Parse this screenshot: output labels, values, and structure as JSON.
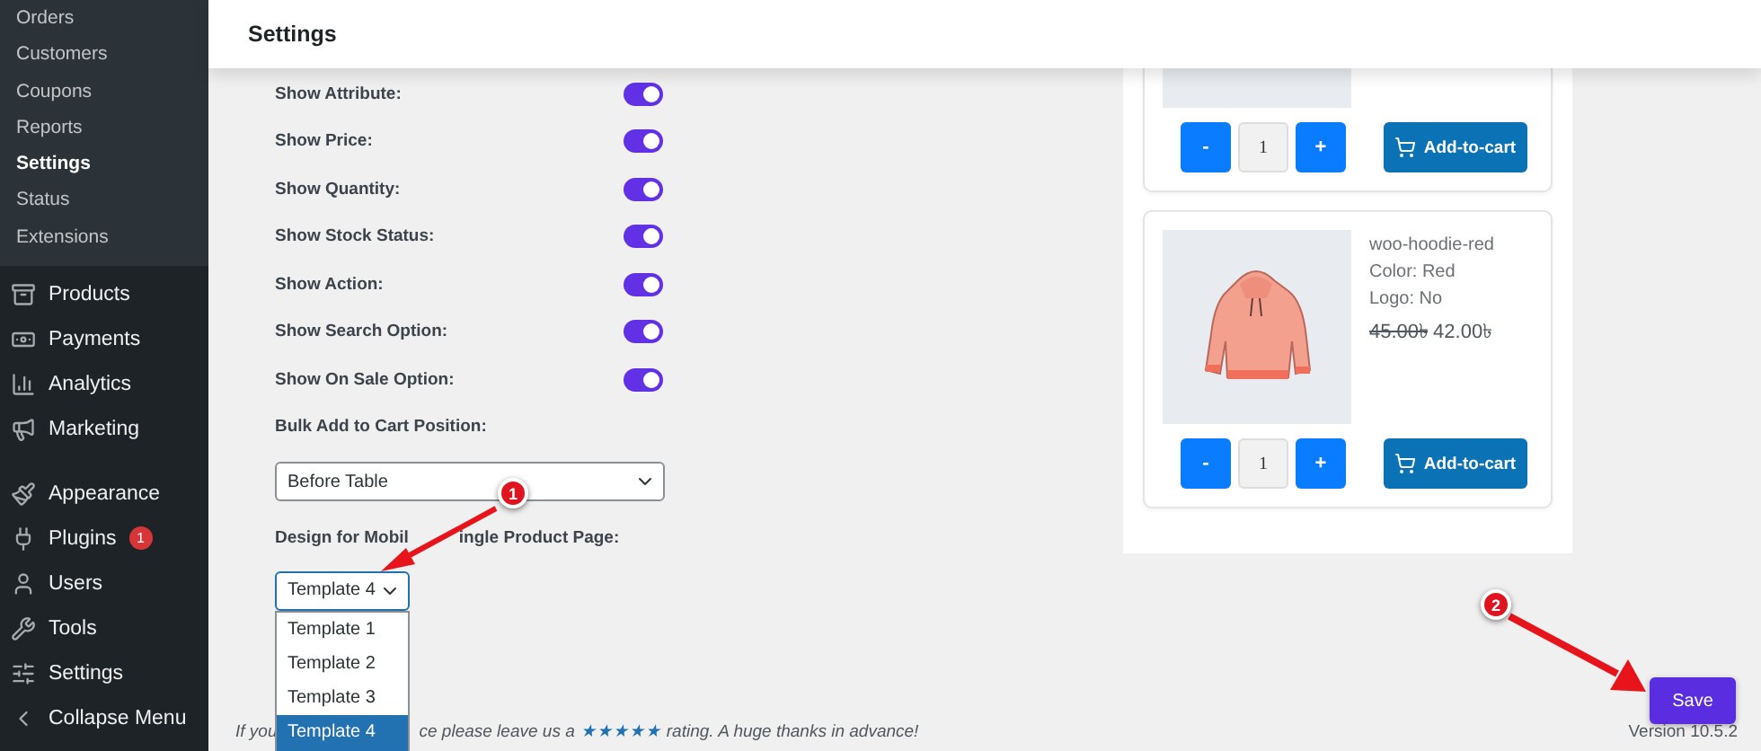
{
  "sidebar": {
    "submenu": [
      {
        "label": "Orders",
        "selected": false
      },
      {
        "label": "Customers",
        "selected": false
      },
      {
        "label": "Coupons",
        "selected": false
      },
      {
        "label": "Reports",
        "selected": false
      },
      {
        "label": "Settings",
        "selected": true
      },
      {
        "label": "Status",
        "selected": false
      },
      {
        "label": "Extensions",
        "selected": false
      }
    ],
    "menu_groups": [
      [
        {
          "label": "Products"
        },
        {
          "label": "Payments"
        },
        {
          "label": "Analytics"
        },
        {
          "label": "Marketing"
        }
      ],
      [
        {
          "label": "Appearance"
        },
        {
          "label": "Plugins",
          "badge": "1"
        },
        {
          "label": "Users"
        },
        {
          "label": "Tools"
        },
        {
          "label": "Settings"
        }
      ]
    ],
    "collapse": "Collapse Menu"
  },
  "header": {
    "title": "Settings"
  },
  "settings": {
    "toggles": [
      {
        "label": "Show Attribute:",
        "on": true
      },
      {
        "label": "Show Price:",
        "on": true
      },
      {
        "label": "Show Quantity:",
        "on": true
      },
      {
        "label": "Show Stock Status:",
        "on": true
      },
      {
        "label": "Show Action:",
        "on": true
      },
      {
        "label": "Show Search Option:",
        "on": true
      },
      {
        "label": "Show On Sale Option:",
        "on": true
      }
    ],
    "bulk_position": {
      "label": "Bulk Add to Cart Position:",
      "value": "Before Table"
    },
    "mobile_design": {
      "label": "Design for Mobil",
      "label_rest": "ingle Product Page:",
      "value": "Template 4",
      "options": [
        {
          "label": "Template 1",
          "selected": false
        },
        {
          "label": "Template 2",
          "selected": false
        },
        {
          "label": "Template 3",
          "selected": false
        },
        {
          "label": "Template 4",
          "selected": true
        }
      ]
    }
  },
  "preview": {
    "cards": [
      {
        "minus": "-",
        "quantity": "1",
        "plus": "+",
        "add_to_cart": "Add-to-cart"
      },
      {
        "name": "woo-hoodie-red",
        "attributes": [
          "Color: Red",
          "Logo: No"
        ],
        "old_price": "45.00৳",
        "price": "42.00৳",
        "minus": "-",
        "quantity": "1",
        "plus": "+",
        "add_to_cart": "Add-to-cart"
      }
    ]
  },
  "footer": {
    "text_start": "If you",
    "text_middle": "ce please leave us a",
    "link": "★★★★★",
    "text_end": "rating. A huge thanks in advance!",
    "version": "Version 10.5.2"
  },
  "save": "Save",
  "annotations": [
    "1",
    "2"
  ]
}
